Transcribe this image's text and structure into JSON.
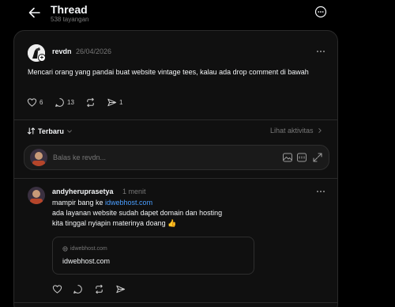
{
  "header": {
    "title": "Thread",
    "views": "538 tayangan"
  },
  "post": {
    "username": "revdn",
    "date": "26/04/2026",
    "text": "Mencari orang yang pandai buat website vintage tees, kalau ada drop comment di bawah",
    "likes": "6",
    "replies": "13",
    "reposts": "",
    "shares": "1"
  },
  "sort": {
    "label": "Terbaru",
    "activity_label": "Lihat aktivitas"
  },
  "reply_box": {
    "placeholder": "Balas ke revdn..."
  },
  "comment": {
    "username": "andyheruprasetya",
    "time": "1 menit",
    "line1_prefix": "mampir bang ke ",
    "line1_link": "idwebhost.com",
    "line2": "ada layanan website sudah dapet domain dan hosting",
    "line3": "kita tinggal nyiapin materinya doang 👍",
    "preview_domain": "idwebhost.com",
    "preview_title": "idwebhost.com"
  },
  "colors": {
    "background": "#000000",
    "card": "#101010",
    "link": "#4a9eff",
    "muted": "#777777"
  }
}
